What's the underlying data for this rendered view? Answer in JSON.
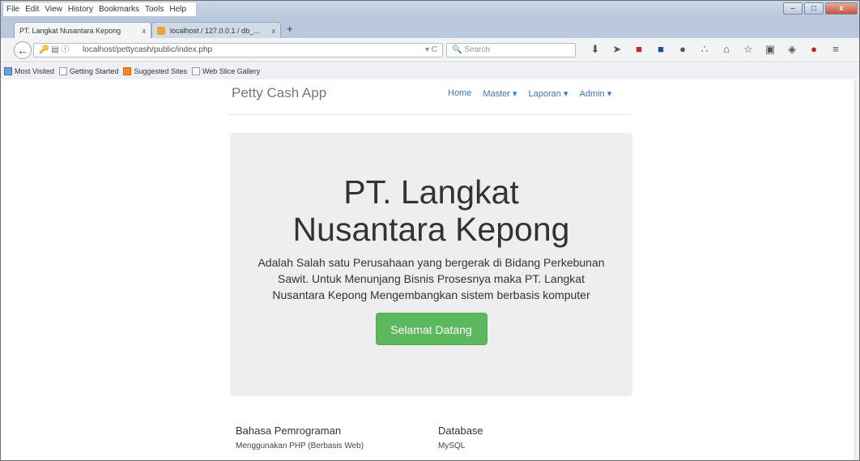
{
  "menu": [
    "File",
    "Edit",
    "View",
    "History",
    "Bookmarks",
    "Tools",
    "Help"
  ],
  "window_controls": {
    "minimize": "–",
    "maximize": "□",
    "close": "x"
  },
  "tabs": [
    {
      "label": "PT. Langkat Nusantara Kepong",
      "close": "x",
      "active": true
    },
    {
      "label": "localhost / 127.0.0.1 / db_...",
      "close": "x",
      "active": false
    }
  ],
  "new_tab": "+",
  "navigation": {
    "back": "←",
    "url": "localhost/pettycash/public/index.php",
    "reload": "C",
    "search_placeholder": "Search"
  },
  "toolbar_icons": [
    "download-icon",
    "send-icon",
    "pocket-red-icon",
    "square-blue-icon",
    "mask-icon",
    "grid-icon",
    "home-icon",
    "star-icon",
    "clipboard-icon",
    "shield-icon",
    "red-badge-icon",
    "menu-icon"
  ],
  "bookmarks": [
    "Most Visited",
    "Getting Started",
    "Suggested Sites",
    "Web Slice Gallery"
  ],
  "site": {
    "brand": "Petty Cash App",
    "nav": [
      "Home",
      "Master ▾",
      "Laporan ▾",
      "Admin ▾"
    ],
    "hero_title": "PT. Langkat Nusantara Kepong",
    "hero_text": "Adalah Salah satu Perusahaan yang bergerak di Bidang Perkebunan Sawit. Untuk Menunjang Bisnis Prosesnya maka PT. Langkat Nusantara Kepong Mengembangkan sistem berbasis komputer",
    "hero_button": "Selamat Datang",
    "columns": [
      {
        "heading": "Bahasa Pemrograman",
        "text": "Menggunakan PHP (Berbasis Web)"
      },
      {
        "heading": "Database",
        "text": "MySQL"
      }
    ]
  },
  "colors": {
    "accent_green": "#5cb85c",
    "link": "#3a78c3",
    "jumbotron": "#eeeeee"
  }
}
